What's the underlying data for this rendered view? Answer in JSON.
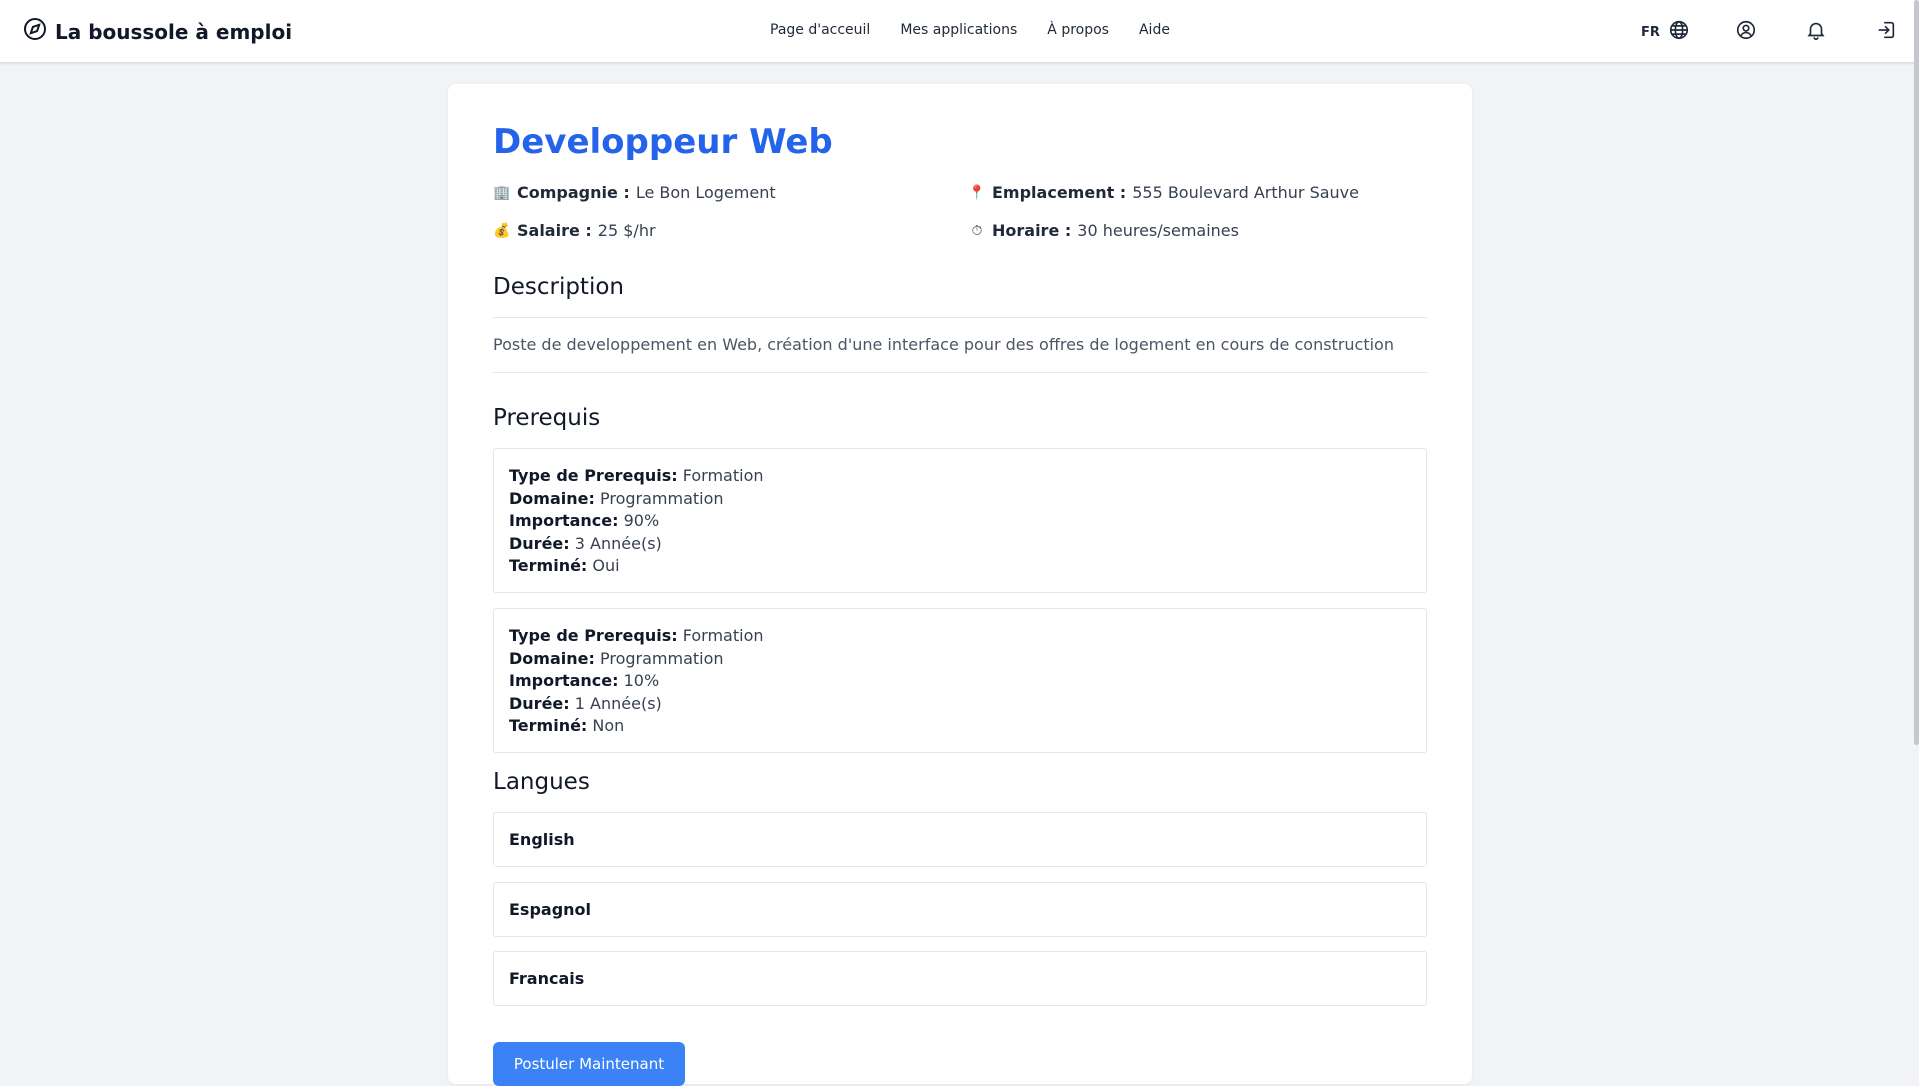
{
  "header": {
    "brand": "La boussole à emploi",
    "nav": [
      "Page d'acceuil",
      "Mes applications",
      "À propos",
      "Aide"
    ],
    "language": "FR",
    "icons": [
      "compass-icon",
      "globe-icon",
      "user-icon",
      "bell-icon",
      "logout-icon"
    ]
  },
  "job": {
    "title": "Developpeur Web",
    "company_label": "Compagnie :",
    "company": "Le Bon Logement",
    "location_label": "Emplacement :",
    "location": "555 Boulevard Arthur Sauve",
    "salary_label": "Salaire :",
    "salary": "25 $/hr",
    "schedule_label": "Horaire :",
    "schedule": "30 heures/semaines",
    "description_heading": "Description",
    "description": "Poste de developpement en Web, création d'une interface pour des offres de logement en cours de construction",
    "prereq_heading": "Prerequis",
    "prereq_labels": {
      "type": "Type de Prerequis:",
      "domain": "Domaine:",
      "importance": "Importance:",
      "duration": "Durée:",
      "done": "Terminé:"
    },
    "prerequisites": [
      {
        "type": "Formation",
        "domain": "Programmation",
        "importance": "90%",
        "duration": "3 Année(s)",
        "done": "Oui"
      },
      {
        "type": "Formation",
        "domain": "Programmation",
        "importance": "10%",
        "duration": "1 Année(s)",
        "done": "Non"
      }
    ],
    "languages_heading": "Langues",
    "languages": [
      "English",
      "Espagnol",
      "Francais"
    ],
    "apply_label": "Postuler Maintenant"
  },
  "colors": {
    "accent": "#2563eb",
    "button": "#3b82f6",
    "background": "#f1f3f6"
  }
}
